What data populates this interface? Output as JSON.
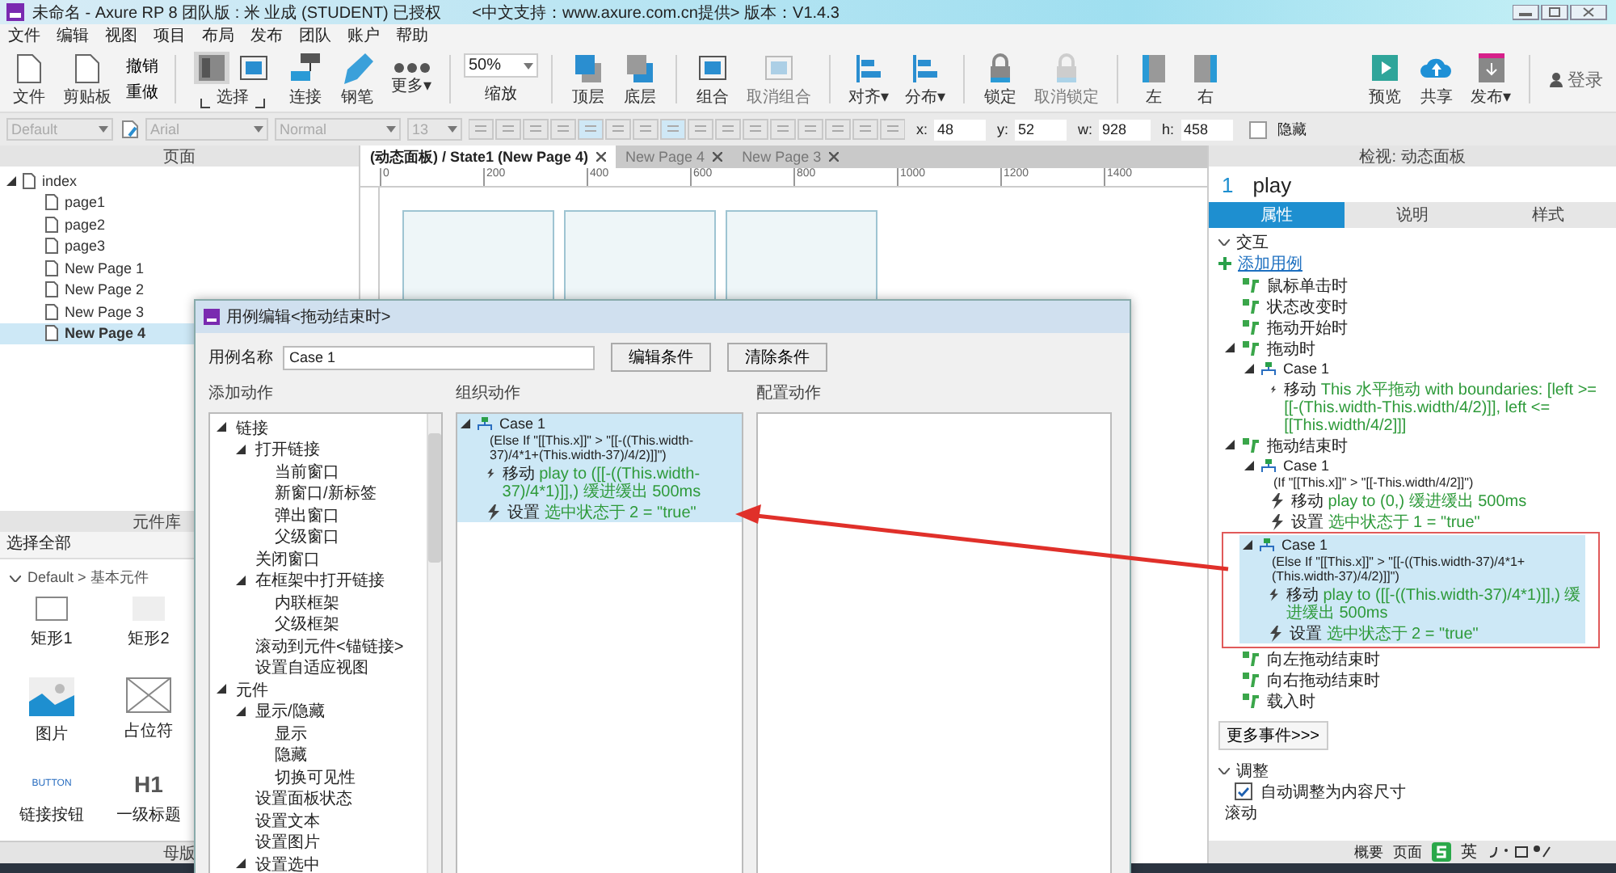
{
  "window": {
    "title": "未命名 - Axure RP 8 团队版 : 米 业成 (STUDENT) 已授权",
    "subtitle": "<中文支持：www.axure.com.cn提供> 版本：V1.4.3"
  },
  "menu": [
    "文件",
    "编辑",
    "视图",
    "项目",
    "布局",
    "发布",
    "团队",
    "账户",
    "帮助"
  ],
  "toolbar": {
    "left": [
      {
        "label": "文件"
      },
      {
        "label": "剪贴板"
      }
    ],
    "history": [
      {
        "label": "撤销"
      },
      {
        "label": "重做"
      }
    ],
    "groups": [
      [
        {
          "kind": "select",
          "label": "选择",
          "disabled": false
        },
        {
          "kind": "tool",
          "label": "连接",
          "disabled": false
        },
        {
          "kind": "tool",
          "label": "钢笔",
          "disabled": false
        },
        {
          "kind": "tool",
          "label": "更多▾",
          "disabled": false
        }
      ],
      [
        {
          "kind": "zoom",
          "value": "50%",
          "label": "缩放"
        }
      ],
      [
        {
          "kind": "tool",
          "label": "顶层",
          "disabled": false
        },
        {
          "kind": "tool",
          "label": "底层",
          "disabled": false
        }
      ],
      [
        {
          "kind": "tool",
          "label": "组合",
          "disabled": false
        },
        {
          "kind": "tool",
          "label": "取消组合",
          "disabled": true
        }
      ],
      [
        {
          "kind": "tool",
          "label": "对齐▾",
          "disabled": false
        },
        {
          "kind": "tool",
          "label": "分布▾",
          "disabled": false
        }
      ],
      [
        {
          "kind": "tool",
          "label": "锁定",
          "disabled": false
        },
        {
          "kind": "tool",
          "label": "取消锁定",
          "disabled": true
        }
      ],
      [
        {
          "kind": "tool",
          "label": "左",
          "disabled": false
        },
        {
          "kind": "tool",
          "label": "右",
          "disabled": false
        }
      ]
    ],
    "right": [
      {
        "label": "预览"
      },
      {
        "label": "共享"
      },
      {
        "label": "发布▾"
      }
    ],
    "login": "登录"
  },
  "format": {
    "fields": [
      "Default",
      "Arial",
      "Normal",
      "13"
    ],
    "geometry": [
      {
        "label": "x:",
        "value": "48"
      },
      {
        "label": "y:",
        "value": "52"
      },
      {
        "label": "w:",
        "value": "928"
      },
      {
        "label": "h:",
        "value": "458"
      }
    ],
    "hidden": {
      "label": "隐藏",
      "checked": false
    }
  },
  "pages": {
    "title": "页面",
    "tree": [
      {
        "label": "index",
        "selected": false,
        "expanded": true,
        "children": [
          {
            "label": "page1",
            "selected": false
          },
          {
            "label": "page2",
            "selected": false
          },
          {
            "label": "page3",
            "selected": false
          },
          {
            "label": "New Page 1",
            "selected": false
          },
          {
            "label": "New Page 2",
            "selected": false
          },
          {
            "label": "New Page 3",
            "selected": false
          },
          {
            "label": "New Page 4",
            "selected": true
          }
        ]
      }
    ]
  },
  "widgets": {
    "title": "元件库",
    "filter": "选择全部",
    "library": "Default > 基本元件",
    "items": [
      {
        "kind": "box",
        "label": "矩形1"
      },
      {
        "kind": "filled",
        "label": "矩形2"
      },
      {
        "kind": "image",
        "label": "图片"
      },
      {
        "kind": "placeholder",
        "label": "占位符"
      },
      {
        "kind": "text",
        "preview": "BUTTON",
        "label": "链接按钮"
      },
      {
        "kind": "heading",
        "preview": "H1",
        "label": "一级标题"
      }
    ]
  },
  "masters": {
    "title": "母版"
  },
  "canvas": {
    "tabs": [
      {
        "label": "(动态面板) / State1 (New Page 4)",
        "selected": true
      },
      {
        "label": "New Page 4",
        "selected": false
      },
      {
        "label": "New Page 3",
        "selected": false
      }
    ],
    "ruler": [
      "0",
      "200",
      "400",
      "600",
      "800",
      "1000",
      "1200",
      "1400"
    ]
  },
  "dialog": {
    "title": "用例编辑<拖动结束时>",
    "name_label": "用例名称",
    "name_value": "Case 1",
    "buttons": [
      "编辑条件",
      "清除条件"
    ],
    "add_title": "添加动作",
    "organize_title": "组织动作",
    "config_title": "配置动作",
    "actions": [
      {
        "label": "链接",
        "expanded": true,
        "children": [
          {
            "label": "打开链接",
            "expanded": true,
            "children": [
              {
                "label": "当前窗口"
              },
              {
                "label": "新窗口/新标签"
              },
              {
                "label": "弹出窗口"
              },
              {
                "label": "父级窗口"
              }
            ]
          },
          {
            "label": "关闭窗口"
          },
          {
            "label": "在框架中打开链接",
            "expanded": true,
            "children": [
              {
                "label": "内联框架"
              },
              {
                "label": "父级框架"
              }
            ]
          },
          {
            "label": "滚动到元件<锚链接>"
          },
          {
            "label": "设置自适应视图"
          }
        ]
      },
      {
        "label": "元件",
        "expanded": true,
        "children": [
          {
            "label": "显示/隐藏",
            "expanded": true,
            "children": [
              {
                "label": "显示"
              },
              {
                "label": "隐藏"
              },
              {
                "label": "切换可见性"
              }
            ]
          },
          {
            "label": "设置面板状态"
          },
          {
            "label": "设置文本"
          },
          {
            "label": "设置图片"
          },
          {
            "label": "设置选中",
            "expanded": true
          }
        ]
      }
    ],
    "case": {
      "name": "Case 1",
      "condition": "(Else If \"[[This.x]]\" > \"[[-((This.width-37)/4*1+(This.width-37)/4/2)]]\")",
      "selected": true,
      "actions": [
        {
          "verb": "移动",
          "detail": "play to ([[-((This.width-37)/4*1)]],) 缓进缓出 500ms"
        },
        {
          "verb": "设置",
          "detail": "选中状态于 2 = \"true\""
        }
      ]
    }
  },
  "inspector": {
    "title": "检视: 动态面板",
    "number": "1",
    "name": "play",
    "tabs": [
      {
        "label": "属性",
        "selected": true
      },
      {
        "label": "说明",
        "selected": false
      },
      {
        "label": "样式",
        "selected": false
      }
    ],
    "section": "交互",
    "add_case": "添加用例",
    "events": [
      {
        "label": "鼠标单击时",
        "expanded": false
      },
      {
        "label": "状态改变时",
        "expanded": false
      },
      {
        "label": "拖动开始时",
        "expanded": false
      },
      {
        "label": "拖动时",
        "expanded": true,
        "cases": [
          {
            "name": "Case 1",
            "selected": false,
            "actions": [
              {
                "verb": "移动",
                "detail": "This 水平拖动 with boundaries: [left >= [[-(This.width-This.width/4/2)]], left <= [[This.width/4/2]]]"
              }
            ]
          }
        ]
      },
      {
        "label": "拖动结束时",
        "expanded": true,
        "cases": [
          {
            "name": "Case 1",
            "condition": "(If \"[[This.x]]\" > \"[[-This.width/4/2]]\")",
            "selected": false,
            "actions": [
              {
                "verb": "移动",
                "detail": "play to (0,) 缓进缓出 500ms"
              },
              {
                "verb": "设置",
                "detail": "选中状态于 1 = \"true\""
              }
            ]
          },
          {
            "name": "Case 1",
            "condition": "(Else If \"[[This.x]]\" > \"[[-((This.width-37)/4*1+(This.width-37)/4/2)]]\")",
            "selected": true,
            "actions": [
              {
                "verb": "移动",
                "detail": "play to ([[-((This.width-37)/4*1)]],) 缓进缓出 500ms"
              },
              {
                "verb": "设置",
                "detail": "选中状态于 2 = \"true\""
              }
            ]
          }
        ]
      },
      {
        "label": "向左拖动结束时",
        "expanded": false
      },
      {
        "label": "向右拖动结束时",
        "expanded": false
      },
      {
        "label": "载入时",
        "expanded": false
      }
    ],
    "more_events": "更多事件>>>",
    "section2": "调整",
    "autofit": {
      "label": "自动调整为内容尺寸",
      "checked": true
    },
    "scroll_label": "滚动"
  },
  "bottom_tabs": [
    "概要",
    "页面"
  ],
  "ime": "英"
}
